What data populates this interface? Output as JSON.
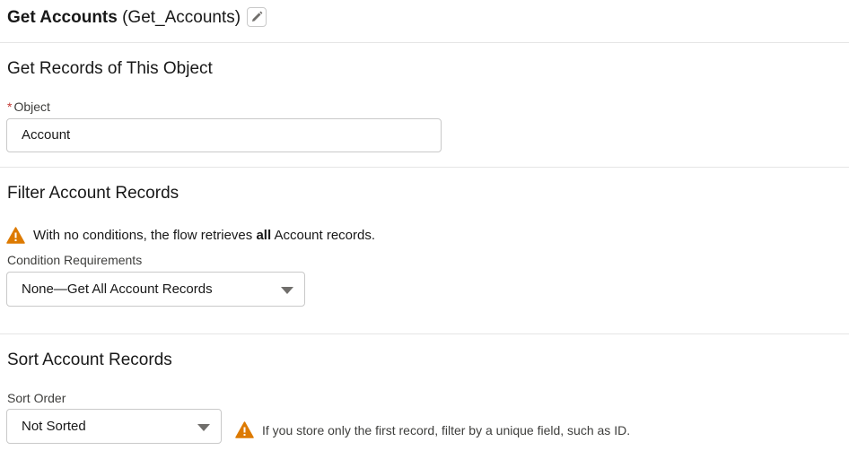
{
  "header": {
    "element_label": "Get Accounts",
    "api_name": "(Get_Accounts)",
    "edit_icon": "pencil-icon"
  },
  "object_section": {
    "title": "Get Records of This Object",
    "field_label": "Object",
    "required_marker": "*",
    "value": "Account"
  },
  "filter_section": {
    "title": "Filter Account Records",
    "warning_icon": "warning-triangle-icon",
    "warning_prefix": "With no conditions, the flow retrieves ",
    "warning_bold": "all",
    "warning_suffix": " Account records.",
    "condition_label": "Condition Requirements",
    "condition_value": "None—Get All Account Records"
  },
  "sort_section": {
    "title": "Sort Account Records",
    "sort_label": "Sort Order",
    "sort_value": "Not Sorted",
    "note_icon": "warning-triangle-icon",
    "note_text": "If you store only the first record, filter by a unique field, such as ID."
  },
  "colors": {
    "warning": "#dd7a01",
    "required": "#c23934",
    "border": "#c9c9c9",
    "divider": "#e5e5e5"
  }
}
